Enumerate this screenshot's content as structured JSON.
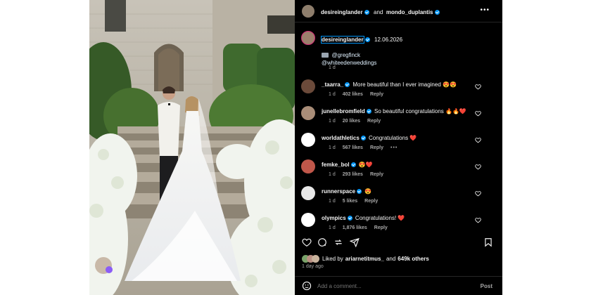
{
  "header": {
    "user1": "desireinglander",
    "joiner": "and",
    "user2": "mondo_duplantis",
    "more_icon": "more-horizontal-icon"
  },
  "caption": {
    "user": "desireinglander",
    "date": "12.06.2026",
    "camera_mention": "@gregfinck",
    "mention2": "@whiteedenweddings",
    "time": "1 d"
  },
  "comments": [
    {
      "user": "_taarra_",
      "text": "More beautiful than I ever imagined 😍😍",
      "time": "1 d",
      "likes": "402 likes",
      "reply": "Reply",
      "avatar_color": "#6b4a3a"
    },
    {
      "user": "junellebromfield",
      "text": "So beautiful congratulations 🔥🔥❤️",
      "time": "1 d",
      "likes": "20 likes",
      "reply": "Reply",
      "avatar_color": "#a98d78"
    },
    {
      "user": "worldathletics",
      "text": "Congratulations ❤️",
      "time": "1 d",
      "likes": "567 likes",
      "reply": "Reply",
      "avatar_color": "#ffffff"
    },
    {
      "user": "femke_bol",
      "text": "😍❤️",
      "time": "1 d",
      "likes": "293 likes",
      "reply": "Reply",
      "avatar_color": "#c0574a"
    },
    {
      "user": "runnerspace",
      "text": "😍",
      "time": "1 d",
      "likes": "5 likes",
      "reply": "Reply",
      "avatar_color": "#e8e8e8"
    },
    {
      "user": "olympics",
      "text": "Congratulations! ❤️",
      "time": "1 d",
      "likes": "1,876 likes",
      "reply": "Reply",
      "avatar_color": "#ffffff"
    }
  ],
  "actions": {
    "liked_by_prefix": "Liked by",
    "liked_by_user": "ariarnetitmus_",
    "liked_by_mid": "and",
    "liked_by_count": "649k others",
    "time_ago": "1 day ago"
  },
  "add_comment": {
    "placeholder": "Add a comment...",
    "post_label": "Post"
  },
  "photo": {
    "alt_icon": "stories-avatar-icon"
  }
}
